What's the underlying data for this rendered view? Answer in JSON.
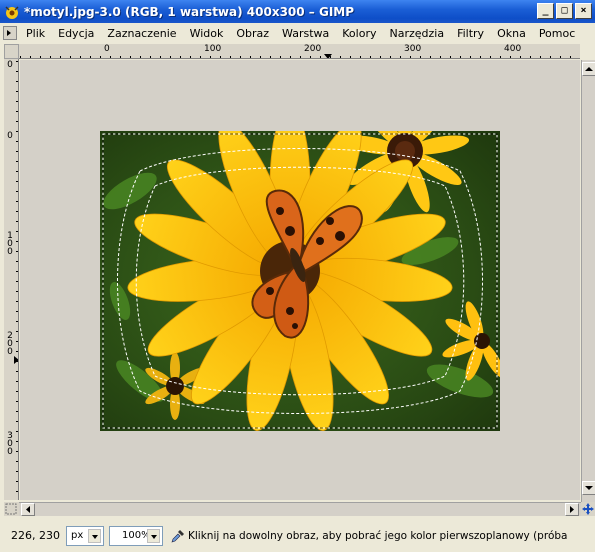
{
  "window": {
    "title": "*motyl.jpg-3.0 (RGB, 1 warstwa) 400x300 – GIMP",
    "minimize": "_",
    "maximize": "□",
    "close": "×"
  },
  "menu": {
    "items": [
      "Plik",
      "Edycja",
      "Zaznaczenie",
      "Widok",
      "Obraz",
      "Warstwa",
      "Kolory",
      "Narzędzia",
      "Filtry",
      "Okna",
      "Pomoc"
    ]
  },
  "rulers": {
    "horizontal_labels": [
      "0",
      "100",
      "200",
      "300",
      "400"
    ],
    "vertical_labels": [
      "0",
      "0",
      "100",
      "200",
      "300"
    ]
  },
  "statusbar": {
    "coords": "226, 230",
    "unit": "px",
    "zoom": "100%",
    "message": "Kliknij na dowolny obraz, aby pobrać jego kolor pierwszoplanowy (próba Shift, ..."
  },
  "icons": {
    "app": "gimp-wilber-icon",
    "picker": "color-picker-icon",
    "navigate": "navigate-icon",
    "quickmask": "quick-mask-icon"
  }
}
